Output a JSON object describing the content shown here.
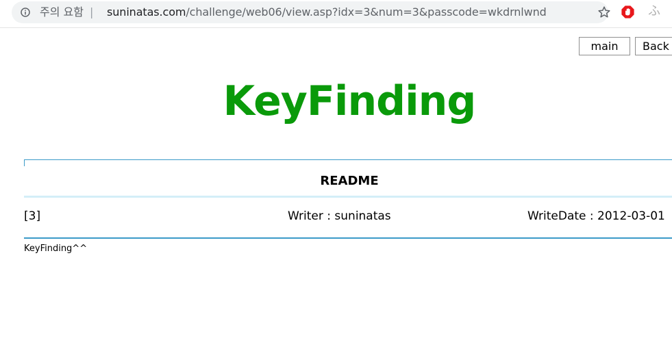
{
  "browser": {
    "security_label": "주의 요함",
    "separator": "|",
    "url_domain": "suninatas.com",
    "url_path": "/challenge/web06/view.asp?idx=3&num=3&passcode=wkdrnlwnd",
    "extension_glyph": "ふ",
    "icons": {
      "site_info": "info-icon",
      "bookmark": "star-icon",
      "extension": "stop-sign-icon"
    },
    "colors": {
      "stop_sign": "#e8181c",
      "omnibox": "#f1f3f4"
    }
  },
  "nav": {
    "main_label": "main",
    "back_label": "Back"
  },
  "page": {
    "title": "KeyFinding",
    "title_color": "#0a9a0a"
  },
  "post": {
    "subject": "README",
    "number": "[3]",
    "writer": "Writer : suninatas",
    "write_date": "WriteDate : 2012-03-01",
    "body": "KeyFinding^^",
    "border_color": "#3a9ac8"
  }
}
